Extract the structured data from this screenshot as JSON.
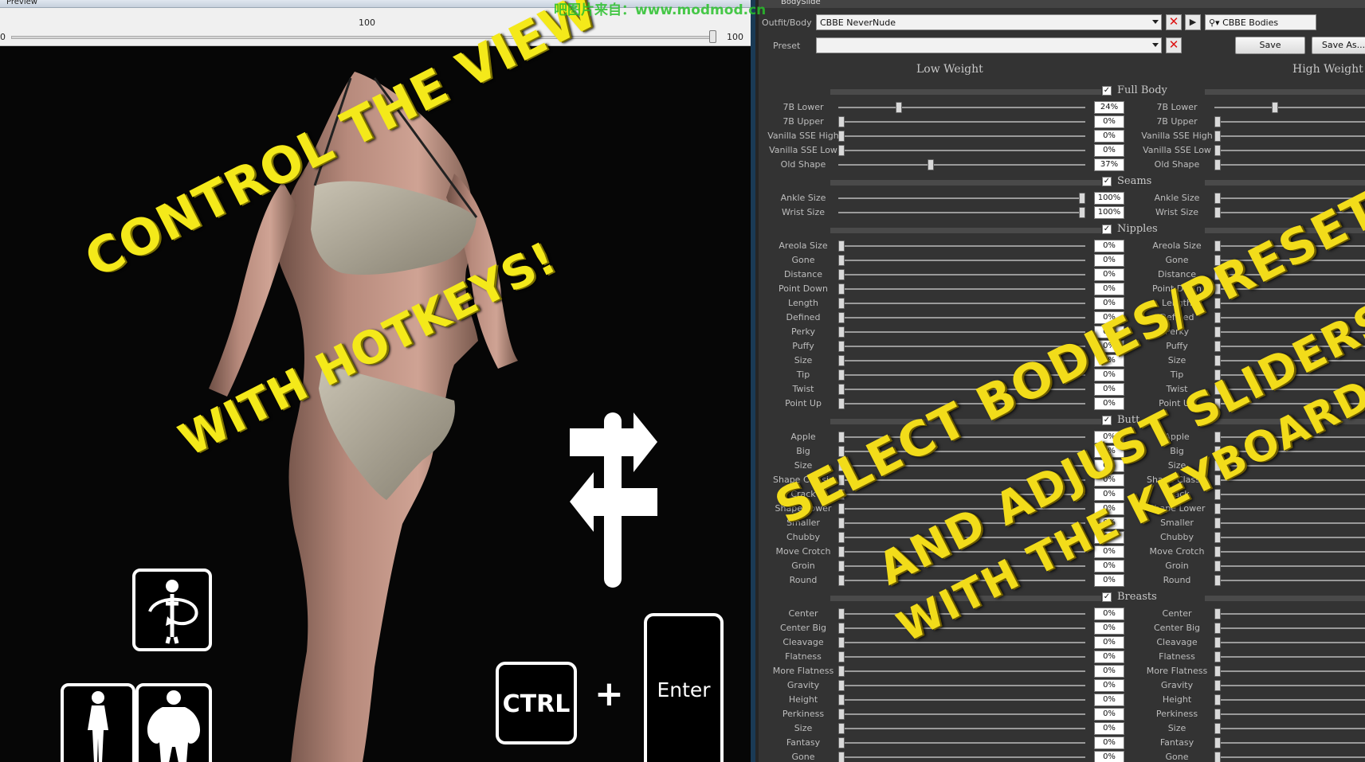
{
  "preview": {
    "title": "Preview",
    "slider_min": "0",
    "slider_mid": "100",
    "slider_max": "100",
    "overlay_line1": "CONTROL THE VIEW",
    "overlay_line2": "WITH HOTKEYS!",
    "key_ctrl": "CTRL",
    "key_plus": "+",
    "key_enter": "Enter"
  },
  "watermark": "吧图片来自：www.modmod.cn",
  "bodyslide": {
    "title": "BodySlide",
    "outfit_label": "Outfit/Body",
    "outfit_value": "CBBE NeverNude",
    "group_filter_value": "CBBE Bodies",
    "preset_label": "Preset",
    "preset_value": "",
    "save_label": "Save",
    "save_as_label": "Save As...",
    "low_weight": "Low Weight",
    "high_weight": "High Weight",
    "overlay_line1": "SELECT BODIES/PRESETS",
    "overlay_line2": "AND ADJUST SLIDERS",
    "overlay_line3": "WITH THE KEYBOARD",
    "groups": [
      {
        "name": "Full Body",
        "sliders": [
          {
            "name": "7B Lower",
            "low": 24,
            "high": 24,
            "display": "24%"
          },
          {
            "name": "7B Upper",
            "low": 0,
            "high": 0,
            "display": "0%"
          },
          {
            "name": "Vanilla SSE High",
            "low": 0,
            "high": 0,
            "display": "0%"
          },
          {
            "name": "Vanilla SSE Low",
            "low": 0,
            "high": 0,
            "display": "0%"
          },
          {
            "name": "Old Shape",
            "low": 37,
            "high": 0,
            "display": "37%"
          }
        ]
      },
      {
        "name": "Seams",
        "sliders": [
          {
            "name": "Ankle Size",
            "low": 100,
            "high": 0,
            "display": "100%"
          },
          {
            "name": "Wrist Size",
            "low": 100,
            "high": 0,
            "display": "100%"
          }
        ]
      },
      {
        "name": "Nipples",
        "sliders": [
          {
            "name": "Areola Size",
            "low": 0,
            "high": 0,
            "display": "0%"
          },
          {
            "name": "Gone",
            "low": 0,
            "high": 0,
            "display": "0%"
          },
          {
            "name": "Distance",
            "low": 0,
            "high": 0,
            "display": "0%"
          },
          {
            "name": "Point Down",
            "low": 0,
            "high": 0,
            "display": "0%"
          },
          {
            "name": "Length",
            "low": 0,
            "high": 0,
            "display": "0%"
          },
          {
            "name": "Defined",
            "low": 0,
            "high": 0,
            "display": "0%"
          },
          {
            "name": "Perky",
            "low": 0,
            "high": 0,
            "display": "0%"
          },
          {
            "name": "Puffy",
            "low": 0,
            "high": 0,
            "display": "0%"
          },
          {
            "name": "Size",
            "low": 0,
            "high": 0,
            "display": "0%"
          },
          {
            "name": "Tip",
            "low": 0,
            "high": 0,
            "display": "0%"
          },
          {
            "name": "Twist",
            "low": 0,
            "high": 0,
            "display": "0%"
          },
          {
            "name": "Point Up",
            "low": 0,
            "high": 0,
            "display": "0%"
          }
        ]
      },
      {
        "name": "Butt",
        "sliders": [
          {
            "name": "Apple",
            "low": 0,
            "high": 0,
            "display": "0%"
          },
          {
            "name": "Big",
            "low": 0,
            "high": 0,
            "display": "0%"
          },
          {
            "name": "Size",
            "low": 0,
            "high": 0,
            "display": "0%"
          },
          {
            "name": "Shape Classic",
            "low": 0,
            "high": 0,
            "display": "0%"
          },
          {
            "name": "Crack",
            "low": 0,
            "high": 0,
            "display": "0%"
          },
          {
            "name": "Shape Lower",
            "low": 0,
            "high": 0,
            "display": "0%"
          },
          {
            "name": "Smaller",
            "low": 0,
            "high": 0,
            "display": "0%"
          },
          {
            "name": "Chubby",
            "low": 0,
            "high": 0,
            "display": "0%"
          },
          {
            "name": "Move Crotch",
            "low": 0,
            "high": 0,
            "display": "0%"
          },
          {
            "name": "Groin",
            "low": 0,
            "high": 0,
            "display": "0%"
          },
          {
            "name": "Round",
            "low": 0,
            "high": 0,
            "display": "0%"
          }
        ]
      },
      {
        "name": "Breasts",
        "sliders": [
          {
            "name": "Center",
            "low": 0,
            "high": 0,
            "display": "0%"
          },
          {
            "name": "Center Big",
            "low": 0,
            "high": 0,
            "display": "0%"
          },
          {
            "name": "Cleavage",
            "low": 0,
            "high": 0,
            "display": "0%"
          },
          {
            "name": "Flatness",
            "low": 0,
            "high": 0,
            "display": "0%"
          },
          {
            "name": "More Flatness",
            "low": 0,
            "high": 0,
            "display": "0%"
          },
          {
            "name": "Gravity",
            "low": 0,
            "high": 0,
            "display": "0%"
          },
          {
            "name": "Height",
            "low": 0,
            "high": 0,
            "display": "0%"
          },
          {
            "name": "Perkiness",
            "low": 0,
            "high": 0,
            "display": "0%"
          },
          {
            "name": "Size",
            "low": 0,
            "high": 0,
            "display": "0%"
          },
          {
            "name": "Fantasy",
            "low": 0,
            "high": 0,
            "display": "0%"
          },
          {
            "name": "Gone",
            "low": 0,
            "high": 0,
            "display": "0%"
          }
        ]
      }
    ]
  }
}
